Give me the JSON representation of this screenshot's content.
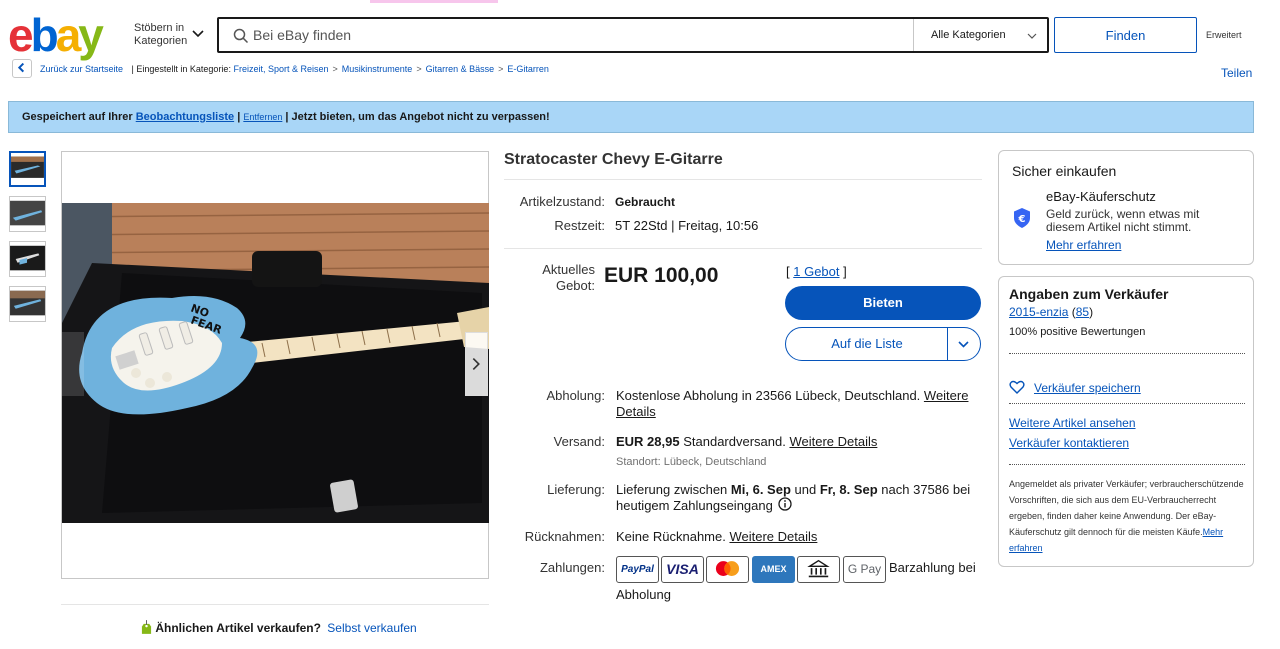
{
  "header": {
    "logo_letters": [
      "e",
      "b",
      "a",
      "y"
    ],
    "browse_line1": "Stöbern in",
    "browse_line2": "Kategorien",
    "search_placeholder": "Bei eBay finden",
    "category_select": "Alle Kategorien",
    "find_label": "Finden",
    "advanced_label": "Erweitert"
  },
  "breadcrumb": {
    "back_label": "Zurück zur Startseite",
    "listed_in": "| Eingestellt in Kategorie:",
    "items": [
      "Freizeit, Sport & Reisen",
      "Musikinstrumente",
      "Gitarren & Bässe",
      "E-Gitarren"
    ],
    "separator": ">",
    "share_label": "Teilen"
  },
  "banner": {
    "saved_text": "Gespeichert auf Ihrer",
    "watchlist_link": "Beobachtungsliste",
    "remove_link": "Entfernen",
    "sep": "|",
    "cta_text": "| Jetzt bieten, um das Angebot nicht zu verpassen!"
  },
  "listing": {
    "title": "Stratocaster Chevy E-Gitarre",
    "condition_label": "Artikelzustand:",
    "condition_value": "Gebraucht",
    "time_label": "Restzeit:",
    "time_value": "5T 22Std | Freitag, 10:56",
    "bid_label_1": "Aktuelles",
    "bid_label_2": "Gebot:",
    "price": "EUR 100,00",
    "bids_open": "[",
    "bids_link": "1 Gebot",
    "bids_close": "]",
    "bid_button": "Bieten",
    "watch_button": "Auf die Liste",
    "pickup_label": "Abholung:",
    "pickup_text": "Kostenlose Abholung in 23566 Lübeck, Deutschland.",
    "pickup_link_1": "Weitere",
    "pickup_link_2": "Details",
    "shipping_label": "Versand:",
    "shipping_price": "EUR 28,95",
    "shipping_text": "Standardversand.",
    "shipping_link": "Weitere Details",
    "shipping_location": "Standort: Lübeck, Deutschland",
    "delivery_label": "Lieferung:",
    "delivery_pre": "Lieferung zwischen",
    "delivery_from": "Mi, 6. Sep",
    "delivery_and": "und",
    "delivery_to": "Fr, 8. Sep",
    "delivery_post": "nach 37586 bei",
    "delivery_line2": "heutigem Zahlungseingang",
    "returns_label": "Rücknahmen:",
    "returns_text": "Keine Rücknahme.",
    "returns_link": "Weitere Details",
    "payments_label": "Zahlungen:",
    "payment_methods": [
      "PayPal",
      "VISA",
      "Mastercard",
      "AMEX",
      "Bank",
      "G Pay"
    ],
    "payment_extra_1": "Barzahlung bei",
    "payment_extra_2": "Abholung"
  },
  "sell_similar": {
    "question": "Ähnlichen Artikel verkaufen?",
    "link": "Selbst verkaufen"
  },
  "safe_buy": {
    "title": "Sicher einkaufen",
    "protection_title": "eBay-Käuferschutz",
    "protection_line1": "Geld zurück, wenn etwas mit",
    "protection_line2": "diesem Artikel nicht stimmt.",
    "more_link": "Mehr erfahren"
  },
  "seller": {
    "title": "Angaben zum Verkäufer",
    "name": "2015-enzia",
    "score_open": "(",
    "score": "85",
    "score_close": ")",
    "positive": "100% positive Bewertungen",
    "save_seller": "Verkäufer speichern",
    "more_items": "Weitere Artikel ansehen",
    "contact": "Verkäufer kontaktieren",
    "fine_print": "Angemeldet als privater Verkäufer; verbraucherschützende Vorschriften, die sich aus dem EU-Verbraucherrecht ergeben, finden daher keine Anwendung. Der eBay-Käuferschutz gilt dennoch für die meisten Käufe.",
    "fine_link": "Mehr erfahren"
  },
  "photo": {
    "sticker_line1": "NO",
    "sticker_line2": "FEAR"
  },
  "colors": {
    "link_blue": "#0654ba",
    "banner_blue": "#a9d6f7",
    "guitar_blue": "#6fb2dd"
  }
}
